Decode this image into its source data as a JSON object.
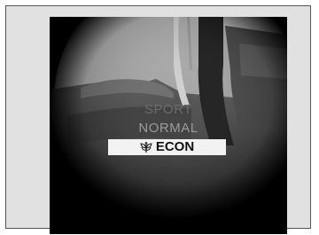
{
  "drive_modes": {
    "sport_label": "SPORT",
    "normal_label": "NORMAL",
    "econ_label": "ECON",
    "selected": "ECON",
    "econ_icon": "leaf-icon"
  },
  "colors": {
    "background": "#e1e1e1",
    "screen": "#0b0b0b",
    "selected_bg": "#f2f2f2",
    "selected_text": "#111111",
    "inactive_text": "#8a8a8a"
  }
}
